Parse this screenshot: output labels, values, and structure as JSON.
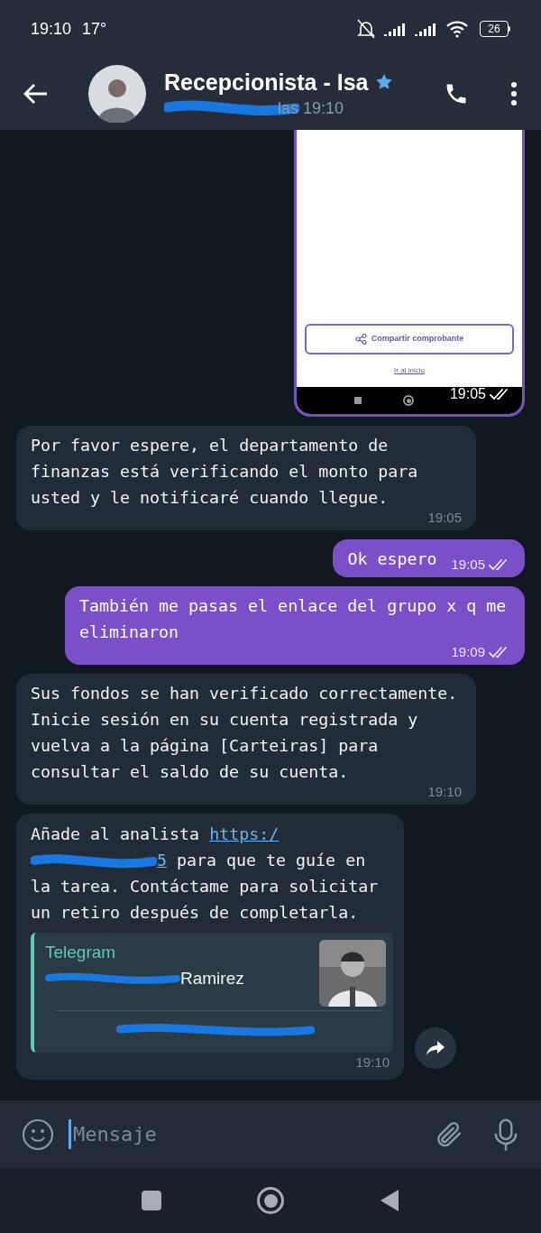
{
  "status_bar": {
    "time": "19:10",
    "temperature": "17°",
    "battery": "26"
  },
  "header": {
    "title": "Recepcionista - Isa",
    "subtitle": "las 19:10",
    "subtitle_redacted": true
  },
  "messages": [
    {
      "outgoing": true,
      "image": {
        "button": "Compartir comprobante",
        "link": "Ir al inicio"
      },
      "time": "19:05",
      "read": true
    },
    {
      "kind": "text",
      "outgoing": false,
      "text": "Por favor espere, el departamento de finanzas está verificando el monto para usted y le notificaré cuando llegue.",
      "time": "19:05"
    },
    {
      "kind": "text",
      "outgoing": true,
      "text": "Ok espero",
      "time": "19:05",
      "read": true
    },
    {
      "kind": "text",
      "outgoing": true,
      "text": "También me pasas el enlace del grupo x q me eliminaron",
      "time": "19:09",
      "read": true
    },
    {
      "kind": "text",
      "outgoing": false,
      "text": "Sus fondos se han verificado correctamente. Inicie sesión en su cuenta registrada y vuelva a la página [Carteiras] para consultar el saldo de su cuenta.",
      "time": "19:10"
    },
    {
      "kind": "link",
      "outgoing": false,
      "parts": [
        {
          "kind": "text",
          "text": "Añade al analista "
        },
        {
          "kind": "link",
          "text": "https:/"
        },
        {
          "kind": "redacted"
        },
        {
          "kind": "link",
          "text": "5"
        },
        {
          "kind": "text",
          "text": " para que te guíe en la tarea. Contáctame para solicitar un retiro después de completarla."
        }
      ],
      "preview": {
        "site": "Telegram",
        "title": "Ramirez",
        "redacted": true
      },
      "time": "19:10"
    }
  ],
  "composer": {
    "placeholder": "Mensaje"
  }
}
